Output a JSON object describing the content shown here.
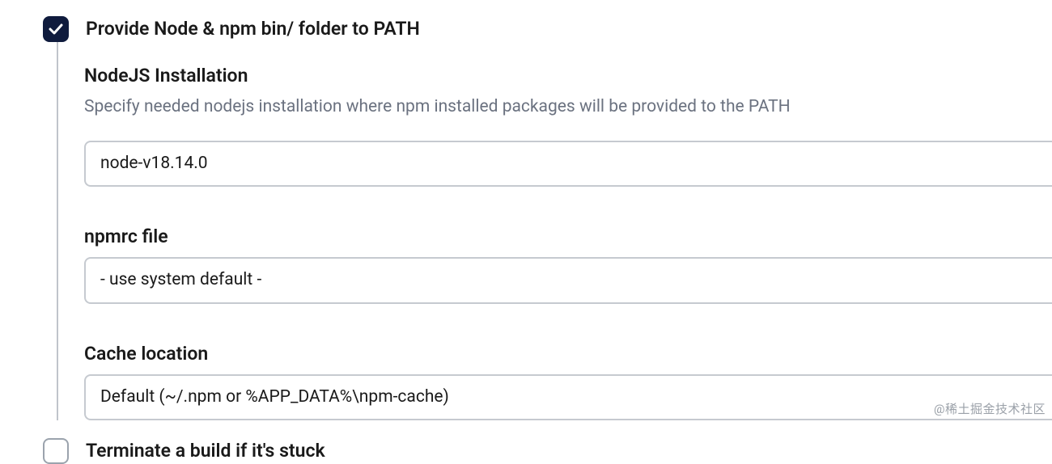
{
  "section_provide_path": {
    "label": "Provide Node & npm bin/ folder to PATH",
    "checked": true
  },
  "nodejs_installation": {
    "title": "NodeJS Installation",
    "help": "Specify needed nodejs installation where npm installed packages will be provided to the PATH",
    "value": "node-v18.14.0"
  },
  "npmrc_file": {
    "title": "npmrc file",
    "value": "- use system default -"
  },
  "cache_location": {
    "title": "Cache location",
    "value": "Default (~/.npm or %APP_DATA%\\npm-cache)"
  },
  "section_terminate": {
    "label": "Terminate a build if it's stuck",
    "checked": false
  },
  "watermark": "@稀土掘金技术社区"
}
